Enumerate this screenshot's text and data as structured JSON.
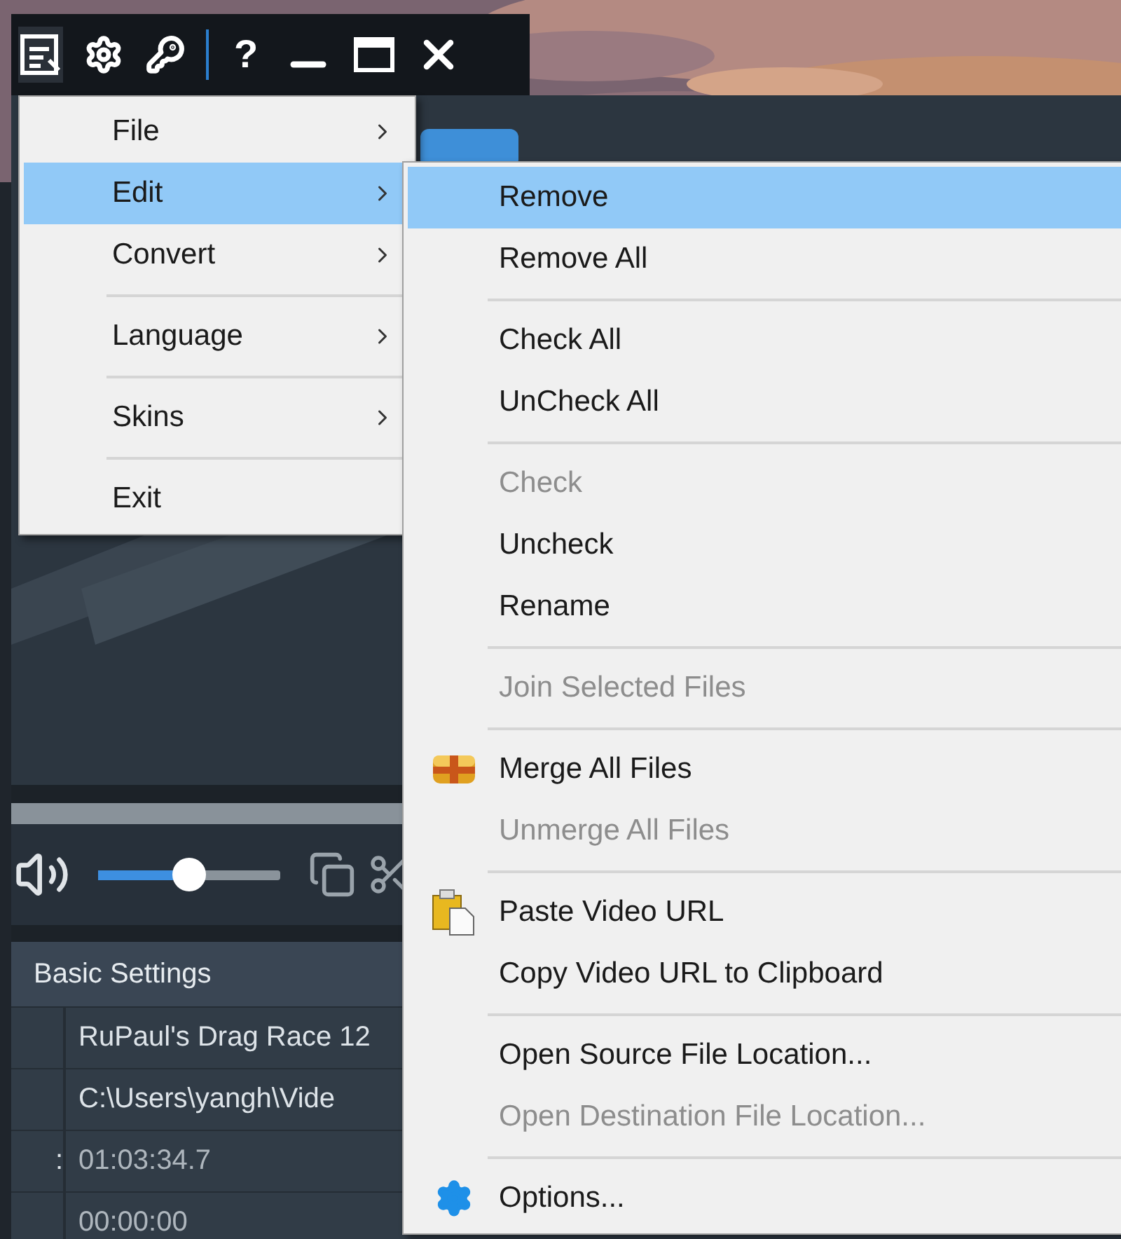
{
  "toolbar": {
    "help": "?"
  },
  "player": {
    "progress": {
      "level": 0
    },
    "volume": {
      "level": 0.5
    }
  },
  "settings": {
    "header": "Basic Settings",
    "rows": [
      {
        "value": "RuPaul's Drag Race 12"
      },
      {
        "value": "C:\\Users\\yangh\\Vide"
      },
      {
        "label": ":",
        "value": "01:03:34.7"
      },
      {
        "value": "00:00:00"
      }
    ]
  },
  "main_menu": {
    "groups": [
      [
        {
          "label": "File",
          "selected": false,
          "submenu": true
        },
        {
          "label": "Edit",
          "selected": true,
          "submenu": true
        },
        {
          "label": "Convert",
          "selected": false,
          "submenu": true
        }
      ],
      [
        {
          "label": "Language",
          "selected": false,
          "submenu": true
        }
      ],
      [
        {
          "label": "Skins",
          "selected": false,
          "submenu": true
        }
      ],
      [
        {
          "label": "Exit",
          "selected": false,
          "submenu": false
        }
      ]
    ]
  },
  "edit_menu": {
    "groups": [
      [
        {
          "label": "Remove",
          "selected": true,
          "disabled": false,
          "kind": "plain"
        },
        {
          "label": "Remove All",
          "selected": false,
          "disabled": false,
          "kind": "plain"
        }
      ],
      [
        {
          "label": "Check All",
          "selected": false,
          "disabled": false,
          "kind": "plain"
        },
        {
          "label": "UnCheck All",
          "selected": false,
          "disabled": false,
          "kind": "plain"
        }
      ],
      [
        {
          "label": "Check",
          "selected": false,
          "disabled": true,
          "kind": "plain"
        },
        {
          "label": "Uncheck",
          "selected": false,
          "disabled": false,
          "kind": "plain"
        },
        {
          "label": "Rename",
          "selected": false,
          "disabled": false,
          "kind": "plain"
        }
      ],
      [
        {
          "label": "Join Selected Files",
          "selected": false,
          "disabled": true,
          "kind": "plain"
        }
      ],
      [
        {
          "label": "Merge All Files",
          "selected": false,
          "disabled": false,
          "kind": "merge"
        },
        {
          "label": "Unmerge All Files",
          "selected": false,
          "disabled": true,
          "kind": "plain"
        }
      ],
      [
        {
          "label": "Paste Video URL",
          "selected": false,
          "disabled": false,
          "kind": "paste"
        },
        {
          "label": "Copy Video URL to Clipboard",
          "selected": false,
          "disabled": false,
          "kind": "plain"
        }
      ],
      [
        {
          "label": "Open Source File Location...",
          "selected": false,
          "disabled": false,
          "kind": "plain"
        },
        {
          "label": "Open Destination File Location...",
          "selected": false,
          "disabled": true,
          "kind": "plain"
        }
      ],
      [
        {
          "label": "Options...",
          "selected": false,
          "disabled": false,
          "kind": "options"
        }
      ]
    ]
  }
}
